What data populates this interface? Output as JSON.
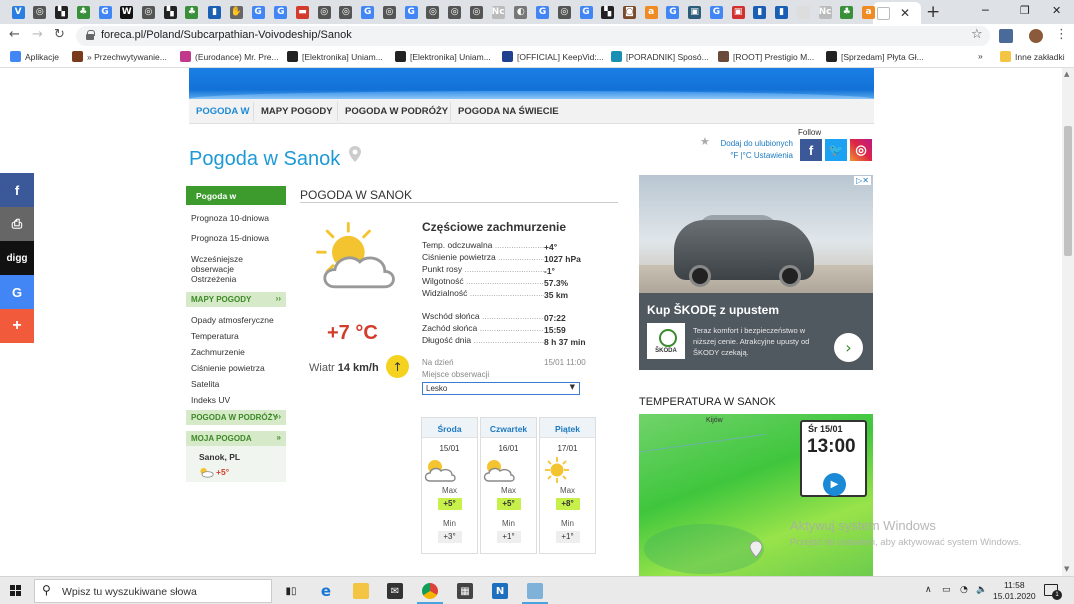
{
  "browser": {
    "tabs": [
      {
        "icon": "v-icon",
        "color": "#2a7de1",
        "glyph": "V"
      },
      {
        "icon": "circle-icon",
        "color": "#555555",
        "glyph": "◎"
      },
      {
        "icon": "flag-icon",
        "color": "#222222",
        "glyph": "▚"
      },
      {
        "icon": "clover-icon",
        "color": "#3a8f3a",
        "glyph": "♣"
      },
      {
        "icon": "google-icon",
        "color": "#4285f4",
        "glyph": "G"
      },
      {
        "icon": "w-icon",
        "color": "#111111",
        "glyph": "W"
      },
      {
        "icon": "circle-icon",
        "color": "#555555",
        "glyph": "◎"
      },
      {
        "icon": "flag-icon",
        "color": "#222222",
        "glyph": "▚"
      },
      {
        "icon": "clover-icon",
        "color": "#3a8f3a",
        "glyph": "♣"
      },
      {
        "icon": "bookmark-icon",
        "color": "#1a5fb4",
        "glyph": "▮"
      },
      {
        "icon": "hand-icon",
        "color": "#666666",
        "glyph": "✋"
      },
      {
        "icon": "google-icon",
        "color": "#4285f4",
        "glyph": "G"
      },
      {
        "icon": "google-icon",
        "color": "#4285f4",
        "glyph": "G"
      },
      {
        "icon": "car-icon",
        "color": "#d33b2c",
        "glyph": "▬"
      },
      {
        "icon": "circle-icon",
        "color": "#555555",
        "glyph": "◎"
      },
      {
        "icon": "circle-icon",
        "color": "#555555",
        "glyph": "◎"
      },
      {
        "icon": "google-icon",
        "color": "#4285f4",
        "glyph": "G"
      },
      {
        "icon": "circle-icon",
        "color": "#555555",
        "glyph": "◎"
      },
      {
        "icon": "google-icon",
        "color": "#4285f4",
        "glyph": "G"
      },
      {
        "icon": "circle-icon",
        "color": "#555555",
        "glyph": "◎"
      },
      {
        "icon": "circle-icon",
        "color": "#555555",
        "glyph": "◎"
      },
      {
        "icon": "circle-icon",
        "color": "#555555",
        "glyph": "◎"
      },
      {
        "icon": "nc-icon",
        "color": "#bbbbbb",
        "glyph": "Nc"
      },
      {
        "icon": "bulb-icon",
        "color": "#777777",
        "glyph": "◐"
      },
      {
        "icon": "google-icon",
        "color": "#4285f4",
        "glyph": "G"
      },
      {
        "icon": "circle-icon",
        "color": "#555555",
        "glyph": "◎"
      },
      {
        "icon": "google-icon",
        "color": "#4285f4",
        "glyph": "G"
      },
      {
        "icon": "flag-icon",
        "color": "#222222",
        "glyph": "▚"
      },
      {
        "icon": "allegro-icon",
        "color": "#7a4a2a",
        "glyph": "◙"
      },
      {
        "icon": "amazon-icon",
        "color": "#f08a24",
        "glyph": "a"
      },
      {
        "icon": "google-icon",
        "color": "#4285f4",
        "glyph": "G"
      },
      {
        "icon": "image-icon",
        "color": "#2b5d7a",
        "glyph": "▣"
      },
      {
        "icon": "google-icon",
        "color": "#4285f4",
        "glyph": "G"
      },
      {
        "icon": "red-app-icon",
        "color": "#d22f2f",
        "glyph": "▣"
      },
      {
        "icon": "bookmark-icon",
        "color": "#1a5fb4",
        "glyph": "▮"
      },
      {
        "icon": "bookmark-icon",
        "color": "#1a5fb4",
        "glyph": "▮"
      },
      {
        "icon": "blank-icon",
        "color": "#dddddd",
        "glyph": " "
      },
      {
        "icon": "nc-icon",
        "color": "#bbbbbb",
        "glyph": "Nc"
      },
      {
        "icon": "clover-icon",
        "color": "#3a8f3a",
        "glyph": "♣"
      },
      {
        "icon": "amazon-icon",
        "color": "#f08a24",
        "glyph": "a"
      }
    ],
    "active_tab_icon": "foreca-icon",
    "url": "foreca.pl/Poland/Subcarpathian-Voivodeship/Sanok",
    "bookmarks": [
      {
        "label": "Aplikacje",
        "icon": "apps-icon",
        "color": "#4285f4"
      },
      {
        "label": "» Przechwytywanie...",
        "icon": "bookmark-icon",
        "color": "#7a3b1a"
      },
      {
        "label": "(Eurodance) Mr. Pre...",
        "icon": "clover-icon",
        "color": "#c0398a"
      },
      {
        "label": "[Elektronika] Uniam...",
        "icon": "circle-icon",
        "color": "#222222"
      },
      {
        "label": "[Elektronika] Uniam...",
        "icon": "circle-icon",
        "color": "#222222"
      },
      {
        "label": "[OFFICIAL] KeepVid:...",
        "icon": "kv-icon",
        "color": "#1f3f8f"
      },
      {
        "label": "[PORADNIK] Sposó...",
        "icon": "bookmark-icon",
        "color": "#1a8fb4"
      },
      {
        "label": "[ROOT] Prestigio M...",
        "icon": "circle-icon",
        "color": "#6b4a3a"
      },
      {
        "label": "[Sprzedam] Płyta Gł...",
        "icon": "e-icon",
        "color": "#222222"
      }
    ],
    "other_bookmarks": "Inne zakładki"
  },
  "site": {
    "nav": [
      "POGODA W",
      "MAPY POGODY",
      "POGODA W PODRÓŻY",
      "POGODA NA ŚWIECIE"
    ],
    "title": "Pogoda w Sanok",
    "add_favorite": "Dodaj do ulubionych",
    "settings": "°F |°C Ustawienia",
    "follow": "Follow",
    "sidebar": {
      "active": "Pogoda w",
      "items": [
        "Prognoza 10-dniowa",
        "Prognoza 15-dniowa",
        "Wcześniejsze obserwacje",
        "Ostrzeżenia"
      ],
      "maps_head": "MAPY POGODY",
      "maps_items": [
        "Opady atmosferyczne",
        "Temperatura",
        "Zachmurzenie",
        "Ciśnienie powietrza",
        "Satelita",
        "Indeks UV"
      ],
      "travel_head": "POGODA W PODRÓŻY",
      "my_head": "MOJA POGODA",
      "my_city": "Sanok, PL",
      "my_temp": "+5°"
    },
    "panel": {
      "title": "POGODA W SANOK",
      "condition": "Częściowe zachmurzenie",
      "temp": "+7 °C",
      "wind_label": "Wiatr",
      "wind_value": "14 km/h",
      "details": [
        {
          "label": "Temp. odczuwalna",
          "value": "+4°"
        },
        {
          "label": "Ciśnienie powietrza",
          "value": "1027 hPa"
        },
        {
          "label": "Punkt rosy",
          "value": "-1°"
        },
        {
          "label": "Wilgotność",
          "value": "57.3%"
        },
        {
          "label": "Widzialność",
          "value": "35 km"
        }
      ],
      "sun": [
        {
          "label": "Wschód słońca",
          "value": "07:22"
        },
        {
          "label": "Zachód słońca",
          "value": "15:59"
        },
        {
          "label": "Długość dnia",
          "value": "8 h 37 min"
        }
      ],
      "date_label": "Na dzień",
      "date_value": "15/01 11:00",
      "station_label": "Miejsce obserwacji",
      "station_value": "Lesko"
    },
    "forecast": [
      {
        "day": "Środa",
        "date": "15/01",
        "max": "+5°",
        "min": "+3°",
        "icon": "partly-cloudy-icon"
      },
      {
        "day": "Czwartek",
        "date": "16/01",
        "max": "+5°",
        "min": "+1°",
        "icon": "partly-cloudy-icon"
      },
      {
        "day": "Piątek",
        "date": "17/01",
        "max": "+8°",
        "min": "+1°",
        "icon": "sun-icon"
      }
    ],
    "forecast_max_label": "Max",
    "forecast_min_label": "Min",
    "ad": {
      "headline": "Kup ŠKODĘ z upustem",
      "text": "Teraz komfort i bezpieczeństwo w niższej cenie. Atrakcyjne upusty od ŠKODY czekają.",
      "logo": "ŠKODA"
    },
    "map": {
      "title": "TEMPERATURA W SANOK",
      "date": "Śr 15/01",
      "time": "13:00",
      "place_label": "Kijów"
    }
  },
  "share": [
    {
      "glyph": "f",
      "icon": "facebook-icon",
      "color": "#3b5998"
    },
    {
      "glyph": "⎙",
      "icon": "print-icon",
      "color": "#666666"
    },
    {
      "glyph": "digg",
      "icon": "digg-icon",
      "color": "#111111"
    },
    {
      "glyph": "G",
      "icon": "google-icon",
      "color": "#4285f4"
    },
    {
      "glyph": "+",
      "icon": "more-icon",
      "color": "#f15a3a"
    }
  ],
  "watermark": {
    "line1": "Aktywuj system Windows",
    "line2": "Przejdź do ustawień, aby aktywować system Windows."
  },
  "taskbar": {
    "search_placeholder": "Wpisz tu wyszukiwane słowa",
    "time": "11:58",
    "date": "15.01.2020",
    "notifications": "1"
  }
}
